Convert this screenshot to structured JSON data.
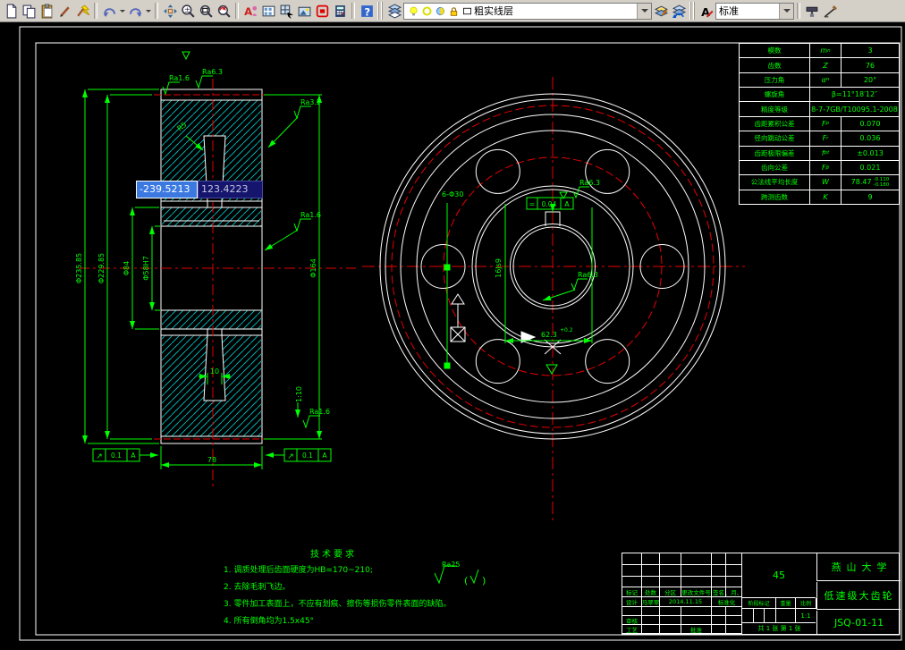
{
  "toolbar": {
    "layer_combo_value": "粗实线层",
    "style_combo_value": "标准",
    "items": [
      {
        "icons": [
          "new-doc-icon",
          "copy-icon",
          "paste-icon",
          "brush-icon",
          "format-painter-icon"
        ]
      },
      {
        "sep": true
      },
      {
        "icons": [
          "undo-icon"
        ]
      },
      {
        "caret": true
      },
      {
        "icons": [
          "redo-icon"
        ]
      },
      {
        "caret": true
      },
      {
        "sep": true
      },
      {
        "icons": [
          "pan-icon",
          "zoom-inout-icon",
          "zoom-window-icon",
          "zoom-previous-icon"
        ]
      },
      {
        "sep": true
      },
      {
        "icons": [
          "annotate-icon",
          "grid-icon",
          "block-icon",
          "render-icon",
          "stamp-icon",
          "calculator-icon"
        ]
      },
      {
        "sep": true
      },
      {
        "icons": [
          "help-icon"
        ]
      },
      {
        "grip": true
      },
      {
        "icons": [
          "layers-icon"
        ]
      },
      {
        "combo": "layer",
        "icons": [
          "bulb-icon",
          "freeze-icon",
          "ball-icon",
          "lock-icon",
          "color-swatch-icon"
        ]
      },
      {
        "icons": [
          "layer-edit-icon",
          "layer-move-icon"
        ]
      },
      {
        "grip": true
      },
      {
        "icons": [
          "font-style-icon"
        ]
      },
      {
        "combo": "style",
        "icons": []
      },
      {
        "sep": true
      },
      {
        "icons": [
          "roller-icon",
          "measure-icon"
        ]
      }
    ]
  },
  "coord_input": {
    "x_value": "-239.5213",
    "y_value": "123.4223"
  },
  "gear_table": {
    "rows": [
      {
        "label": "模数",
        "sym": "m",
        "sub": "n",
        "value": "3"
      },
      {
        "label": "齿数",
        "sym": "Z",
        "sub": "",
        "value": "76"
      },
      {
        "label": "压力角",
        "sym": "α",
        "sub": "n",
        "value": "20°"
      },
      {
        "label": "螺旋角",
        "sym": "",
        "sub": "",
        "value": "β=11°18′12″",
        "merged": true
      },
      {
        "label": "精度等级",
        "sym": "",
        "sub": "",
        "value": "8-7-7GB/T10095.1-2008",
        "merged": true
      },
      {
        "label": "齿距累积公差",
        "sym": "F",
        "sub": "p",
        "value": "0.070"
      },
      {
        "label": "径向跳动公差",
        "sym": "F",
        "sub": "r",
        "value": "0.036"
      },
      {
        "label": "齿距极限偏差",
        "sym": "f",
        "sub": "pt",
        "value": "±0.013"
      },
      {
        "label": "齿向公差",
        "sym": "F",
        "sub": "β",
        "value": "0.021"
      },
      {
        "label": "公法线平均长度",
        "sym": "W",
        "sub": "",
        "value": "78.47",
        "tol_up": "-0.110",
        "tol_dn": "-0.180"
      },
      {
        "label": "跨测齿数",
        "sym": "K",
        "sub": "",
        "value": "9"
      }
    ]
  },
  "tech_req": {
    "title": "技术要求",
    "lines": [
      "1. 调质处理后齿面硬度为HB=170~210;",
      "2. 去除毛刺飞边。",
      "3. 零件加工表面上，不应有划痕、擦伤等损伤零件表面的缺陷。",
      "4. 所有倒角均为1.5x45°"
    ],
    "roughness_note": "Ra25",
    "paren_open": "(",
    "paren_close": ")"
  },
  "title_block": {
    "header_row": [
      "标记",
      "处数",
      "分区",
      "更改文件号",
      "签名",
      "年、月、日"
    ],
    "design_label": "设计",
    "designer": "马翠翠",
    "design_date": "2014.11.15",
    "standard_label": "标准化",
    "check_label": "审核",
    "process_label": "工艺",
    "approve_label": "批准",
    "material": "45",
    "stage_header": [
      "阶段标记",
      "重量",
      "比例"
    ],
    "scale": "1:1",
    "sheet_text": "共 1 张  第 1 张",
    "school": "燕山大学",
    "part_name": "低速级大齿轮",
    "drawing_no": "JSQ-01-11"
  },
  "annotations": {
    "dim_tip": "Φ235.85",
    "dim_root": "Φ229.85",
    "dim_hub": "Φ84",
    "dim_bore": "Φ58H7",
    "dim_web": "Φ164",
    "ra_16_a": "Ra1.6",
    "ra_63_a": "Ra6.3",
    "ra_32": "Ra3.2",
    "ra_16_b": "Ra1.6",
    "ra_16_c": "Ra1.6",
    "r5": "R5",
    "taper": "1:10",
    "dim_10": "10",
    "dim_78": "78",
    "tol_runout_sym": "↗",
    "tol_runout_val": "0.1",
    "tol_runout_ref": "A",
    "holes": "6-Φ30",
    "key_tol_sym": "=",
    "key_tol_val": "0.04",
    "key_tol_ref": "A",
    "ra_63_b": "Ra6.3",
    "ra_63_c": "Ra6.3",
    "key_width": "16Js9",
    "key_depth": "62.3",
    "key_depth_tol": "+0.2"
  },
  "colors": {
    "annotation_green": "#00ff00",
    "outline_white": "#ffffff",
    "centerline_red": "#e60000",
    "hatch_cyan": "#00cccc",
    "coord_x_bg": "#3b79e1",
    "coord_y_bg": "#15156e",
    "toolbar_bg": "#d4d0c8"
  }
}
